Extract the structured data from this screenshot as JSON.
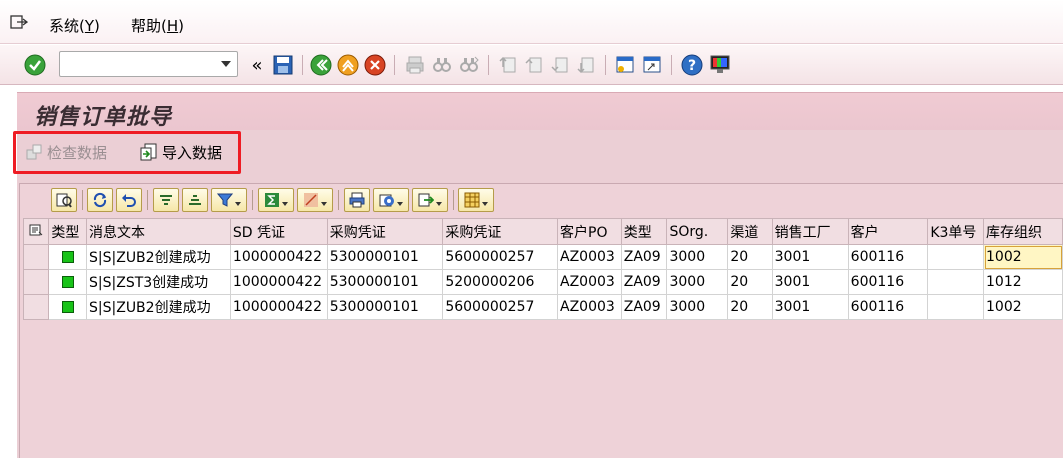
{
  "menubar": {
    "items": [
      {
        "label": "系统(",
        "acc": "Y",
        "end": ")"
      },
      {
        "label": "帮助(",
        "acc": "H",
        "end": ")"
      }
    ]
  },
  "toolbar": {
    "command_value": "",
    "icons": [
      "enter-icon",
      "save-icon",
      "back-icon",
      "exit-icon",
      "cancel-icon",
      "print-icon",
      "find-icon",
      "find-next-icon",
      "first-page-icon",
      "prev-page-icon",
      "next-page-icon",
      "last-page-icon",
      "new-session-icon",
      "shortcut-icon",
      "help-icon",
      "customize-layout-icon"
    ]
  },
  "title": "销售订单批导",
  "app_toolbar": {
    "check_label": "检查数据",
    "import_label": "导入数据"
  },
  "grid": {
    "columns": [
      "类型",
      "消息文本",
      "SD 凭证",
      "采购凭证",
      "采购凭证",
      "客户PO",
      "类型",
      "SOrg.",
      "渠道",
      "销售工厂",
      "客户",
      "K3单号",
      "库存组织"
    ],
    "rows": [
      {
        "msg": "S|S|ZUB2创建成功",
        "sd": "1000000422",
        "po1": "5300000101",
        "po2": "5600000257",
        "cpo": "AZ0003",
        "type": "ZA09",
        "sorg": "3000",
        "channel": "20",
        "plant": "3001",
        "customer": "600116",
        "k3": "",
        "stock": "1002"
      },
      {
        "msg": "S|S|ZST3创建成功",
        "sd": "1000000422",
        "po1": "5300000101",
        "po2": "5200000206",
        "cpo": "AZ0003",
        "type": "ZA09",
        "sorg": "3000",
        "channel": "20",
        "plant": "3001",
        "customer": "600116",
        "k3": "",
        "stock": "1012"
      },
      {
        "msg": "S|S|ZUB2创建成功",
        "sd": "1000000422",
        "po1": "5300000101",
        "po2": "5600000257",
        "cpo": "AZ0003",
        "type": "ZA09",
        "sorg": "3000",
        "channel": "20",
        "plant": "3001",
        "customer": "600116",
        "k3": "",
        "stock": "1002"
      }
    ]
  },
  "colors": {
    "status_green": "#18c318",
    "highlight_red": "#ee1c24",
    "background_pink": "#ebcfd5"
  }
}
